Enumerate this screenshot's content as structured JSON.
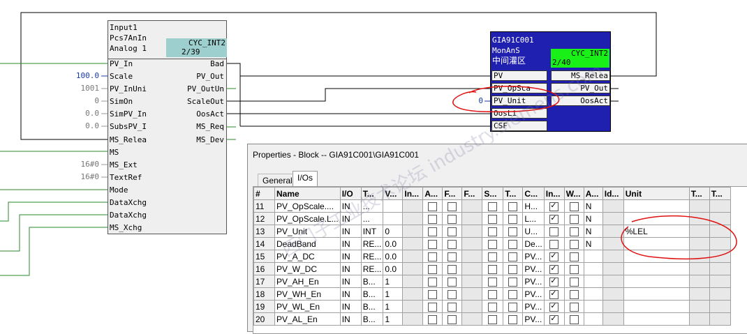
{
  "block1": {
    "header_lines": [
      "Input1",
      "Pcs7AnIn",
      "Analog 1"
    ],
    "cyc_line1": "CYC_INT2",
    "cyc_line2": "2/39",
    "inputs": [
      {
        "name": "PV_In",
        "value": ""
      },
      {
        "name": "Scale",
        "value": "100.0"
      },
      {
        "name": "PV_InUni",
        "value": "1001"
      },
      {
        "name": "SimOn",
        "value": "0"
      },
      {
        "name": "SimPV_In",
        "value": "0.0"
      },
      {
        "name": "SubsPV_I",
        "value": "0.0"
      },
      {
        "name": "MS_Relea",
        "value": ""
      },
      {
        "name": "MS",
        "value": ""
      },
      {
        "name": "MS_Ext",
        "value": "16#0"
      },
      {
        "name": "TextRef",
        "value": "16#0"
      },
      {
        "name": "Mode",
        "value": ""
      },
      {
        "name": "DataXchg",
        "value": ""
      },
      {
        "name": "DataXchg",
        "value": ""
      },
      {
        "name": "MS_Xchg",
        "value": ""
      }
    ],
    "outputs": [
      "Bad",
      "PV_Out",
      "PV_OutUn",
      "ScaleOut",
      "OosAct",
      "MS_Req",
      "MS_Dev"
    ]
  },
  "block2": {
    "header_lines": [
      "GIA91C001",
      "MonAnS",
      "中间灌区"
    ],
    "cyc_line1": "CYC_INT2",
    "cyc_line2": "2/40",
    "inputs": [
      {
        "name": "PV",
        "value": ""
      },
      {
        "name": "PV_OpSca",
        "value": ""
      },
      {
        "name": "PV_Unit",
        "value": "0"
      },
      {
        "name": "OosLi",
        "value": ""
      },
      {
        "name": "CSF",
        "value": ""
      }
    ],
    "outputs": [
      "MS_Relea",
      "PV_Out",
      "OosAct"
    ]
  },
  "dialog": {
    "title": "Properties - Block -- GIA91C001\\GIA91C001",
    "tabs": [
      "General",
      "I/Os"
    ],
    "columns": [
      "#",
      "Name",
      "I/O",
      "T...",
      "V...",
      "In...",
      "A...",
      "F...",
      "F...",
      "S...",
      "T...",
      "C...",
      "In...",
      "W...",
      "A...",
      "Id...",
      "Unit",
      "T...",
      "T..."
    ],
    "rows": [
      {
        "num": "11",
        "name": "PV_OpScale....",
        "io": "IN",
        "type": "...",
        "value": "",
        "c": "H...",
        "in": true,
        "w": false,
        "a": "N",
        "unit": ""
      },
      {
        "num": "12",
        "name": "PV_OpScale.L...",
        "io": "IN",
        "type": "...",
        "value": "",
        "c": "L...",
        "in": true,
        "w": false,
        "a": "N",
        "unit": ""
      },
      {
        "num": "13",
        "name": "PV_Unit",
        "io": "IN",
        "type": "INT",
        "value": "0",
        "c": "U...",
        "in": false,
        "w": false,
        "a": "N",
        "unit": "%LEL"
      },
      {
        "num": "14",
        "name": "DeadBand",
        "io": "IN",
        "type": "RE...",
        "value": "0.0",
        "c": "De...",
        "in": false,
        "w": false,
        "a": "N",
        "unit": ""
      },
      {
        "num": "15",
        "name": "PV_A_DC",
        "io": "IN",
        "type": "RE...",
        "value": "0.0",
        "c": "PV...",
        "in": true,
        "w": false,
        "a": "",
        "unit": ""
      },
      {
        "num": "16",
        "name": "PV_W_DC",
        "io": "IN",
        "type": "RE...",
        "value": "0.0",
        "c": "PV...",
        "in": true,
        "w": false,
        "a": "",
        "unit": ""
      },
      {
        "num": "17",
        "name": "PV_AH_En",
        "io": "IN",
        "type": "B...",
        "value": "1",
        "c": "PV...",
        "in": true,
        "w": false,
        "a": "",
        "unit": ""
      },
      {
        "num": "18",
        "name": "PV_WH_En",
        "io": "IN",
        "type": "B...",
        "value": "1",
        "c": "PV...",
        "in": true,
        "w": false,
        "a": "",
        "unit": ""
      },
      {
        "num": "19",
        "name": "PV_WL_En",
        "io": "IN",
        "type": "B...",
        "value": "1",
        "c": "PV...",
        "in": true,
        "w": false,
        "a": "",
        "unit": ""
      },
      {
        "num": "20",
        "name": "PV_AL_En",
        "io": "IN",
        "type": "B...",
        "value": "1",
        "c": "PV...",
        "in": true,
        "w": false,
        "a": "",
        "unit": ""
      }
    ]
  },
  "watermark": "西门子工业技术论坛 industry.siemens.com"
}
